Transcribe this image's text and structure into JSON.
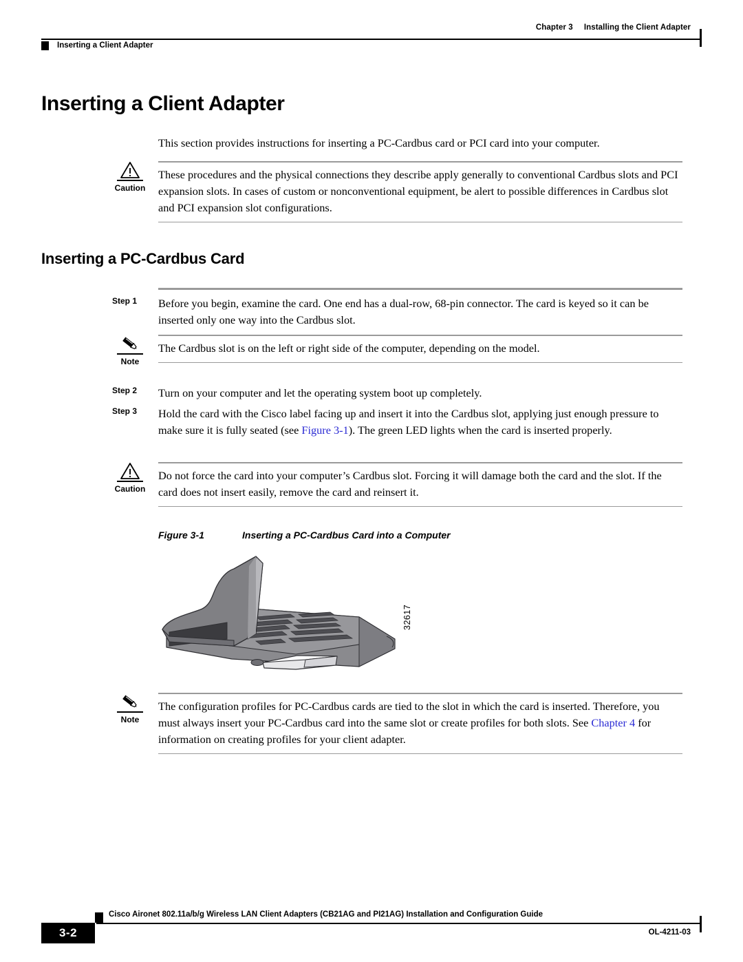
{
  "header": {
    "chapter_number": "Chapter 3",
    "chapter_title": "Installing the Client Adapter",
    "section_marker": "Inserting a Client Adapter"
  },
  "main": {
    "title": "Inserting a Client Adapter",
    "intro": "This section provides instructions for inserting a PC-Cardbus card or PCI card into your computer.",
    "caution_1": {
      "label": "Caution",
      "icon": "warning-triangle-icon",
      "text": "These procedures and the physical connections they describe apply generally to conventional Cardbus slots and PCI expansion slots. In cases of custom or nonconventional equipment, be alert to possible differences in Cardbus slot and PCI expansion slot configurations."
    },
    "subsection_title": "Inserting a PC-Cardbus Card",
    "steps": [
      {
        "label": "Step 1",
        "text": "Before you begin, examine the card. One end has a dual-row, 68-pin connector. The card is keyed so it can be inserted only one way into the Cardbus slot."
      },
      {
        "label": "Step 2",
        "text": "Turn on your computer and let the operating system boot up completely."
      },
      {
        "label": "Step 3",
        "text_before": "Hold the card with the Cisco label facing up and insert it into the Cardbus slot, applying just enough pressure to make sure it is fully seated (see ",
        "link": "Figure 3-1",
        "text_after": "). The green LED lights when the card is inserted properly."
      }
    ],
    "note_1": {
      "label": "Note",
      "icon": "pencil-icon",
      "text": "The Cardbus slot is on the left or right side of the computer, depending on the model."
    },
    "caution_2": {
      "label": "Caution",
      "icon": "warning-triangle-icon",
      "text": "Do not force the card into your computer’s Cardbus slot. Forcing it will damage both the card and the slot. If the card does not insert easily, remove the card and reinsert it."
    },
    "figure": {
      "number": "Figure 3-1",
      "caption": "Inserting a PC-Cardbus Card into a Computer",
      "artwork_id": "32617",
      "alt": "Isometric drawing of an open laptop computer with a PC-Cardbus card being inserted into the side slot"
    },
    "note_2": {
      "label": "Note",
      "icon": "pencil-icon",
      "text_before": "The configuration profiles for PC-Cardbus cards are tied to the slot in which the card is inserted. Therefore, you must always insert your PC-Cardbus card into the same slot or create profiles for both slots. See ",
      "link": "Chapter 4",
      "text_after": " for information on creating profiles for your client adapter."
    }
  },
  "footer": {
    "page_number": "3-2",
    "document_title": "Cisco Aironet 802.11a/b/g Wireless LAN Client Adapters (CB21AG and PI21AG) Installation and Configuration Guide",
    "document_id": "OL-4211-03"
  },
  "colors": {
    "link": "#2a2ad4",
    "rule_gray": "#9a9a9a",
    "text": "#000000",
    "figure_body": "#808084",
    "figure_dark": "#3b3b3f"
  }
}
